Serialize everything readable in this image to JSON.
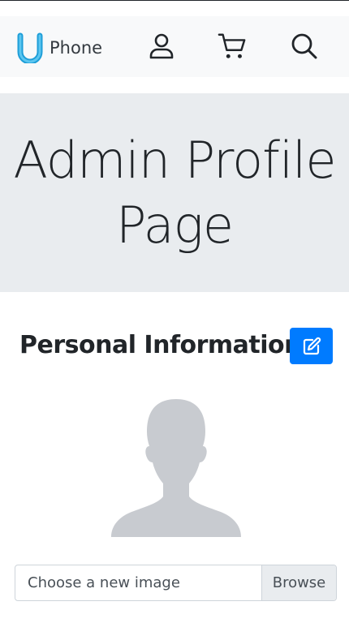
{
  "brand": {
    "letter": "U",
    "name": "Phone",
    "logo_color": "#1e9ed8"
  },
  "nav": {
    "icons": [
      "user-icon",
      "cart-icon",
      "search-icon"
    ]
  },
  "hero": {
    "title": "Admin Profile Page"
  },
  "profile": {
    "heading": "Personal Information",
    "edit_icon": "edit-icon",
    "avatar_icon": "person-silhouette"
  },
  "upload": {
    "placeholder": "Choose a new image",
    "browse_label": "Browse"
  },
  "colors": {
    "navbar_bg": "#f8f9fa",
    "jumbotron_bg": "#e9ecef",
    "primary": "#007bff",
    "avatar_fill": "#c8cbd0"
  }
}
